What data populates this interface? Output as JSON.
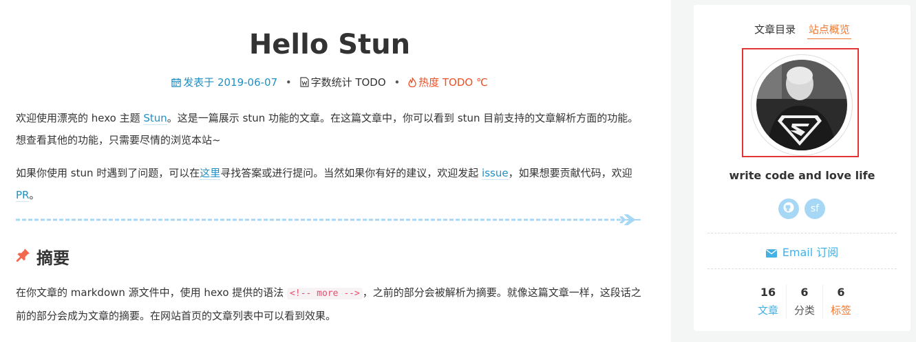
{
  "post": {
    "title": "Hello Stun",
    "meta": {
      "date": "发表于 2019-06-07",
      "words": "字数统计 TODO",
      "heat": "热度 TODO ℃"
    },
    "para1": {
      "t1": "欢迎使用漂亮的 hexo 主题 ",
      "link": "Stun",
      "t2": "。这是一篇展示 stun 功能的文章。在这篇文章中，你可以看到 stun 目前支持的文章解析方面的功能。想查看其他的功能，只需要尽情的浏览本站~"
    },
    "para2": {
      "t1": "如果你使用 stun 时遇到了问题，可以在",
      "link1": "这里",
      "t2": "寻找答案或进行提问。当然如果你有好的建议，欢迎发起 ",
      "link2": "issue",
      "t3": "，如果想要贡献代码，欢迎 ",
      "link3": "PR",
      "t4": "。"
    },
    "heading": "摘要",
    "para3": {
      "t1": "在你文章的 markdown 源文件中，使用 hexo 提供的语法 ",
      "code": "<!-- more -->",
      "t2": "，之前的部分会被解析为摘要。就像这篇文章一样，这段话之前的部分会成为文章的摘要。在网站首页的文章列表中可以看到效果。"
    }
  },
  "sidebar": {
    "tabs": [
      "文章目录",
      "站点概览"
    ],
    "active_tab": "站点概览",
    "motto": "write code and love life",
    "social": [
      {
        "icon": "github-icon",
        "label": ""
      },
      {
        "icon": "segmentfault-icon",
        "label": "sf"
      }
    ],
    "email": "Email 订阅",
    "stats": [
      {
        "num": "16",
        "label": "文章"
      },
      {
        "num": "6",
        "label": "分类"
      },
      {
        "num": "6",
        "label": "标签"
      }
    ]
  },
  "colors": {
    "link": "#1e90c6",
    "heat": "#f04e23",
    "accent_orange": "#f07830",
    "accent_blue": "#43b0e6",
    "highlight_box": "#e03333"
  }
}
